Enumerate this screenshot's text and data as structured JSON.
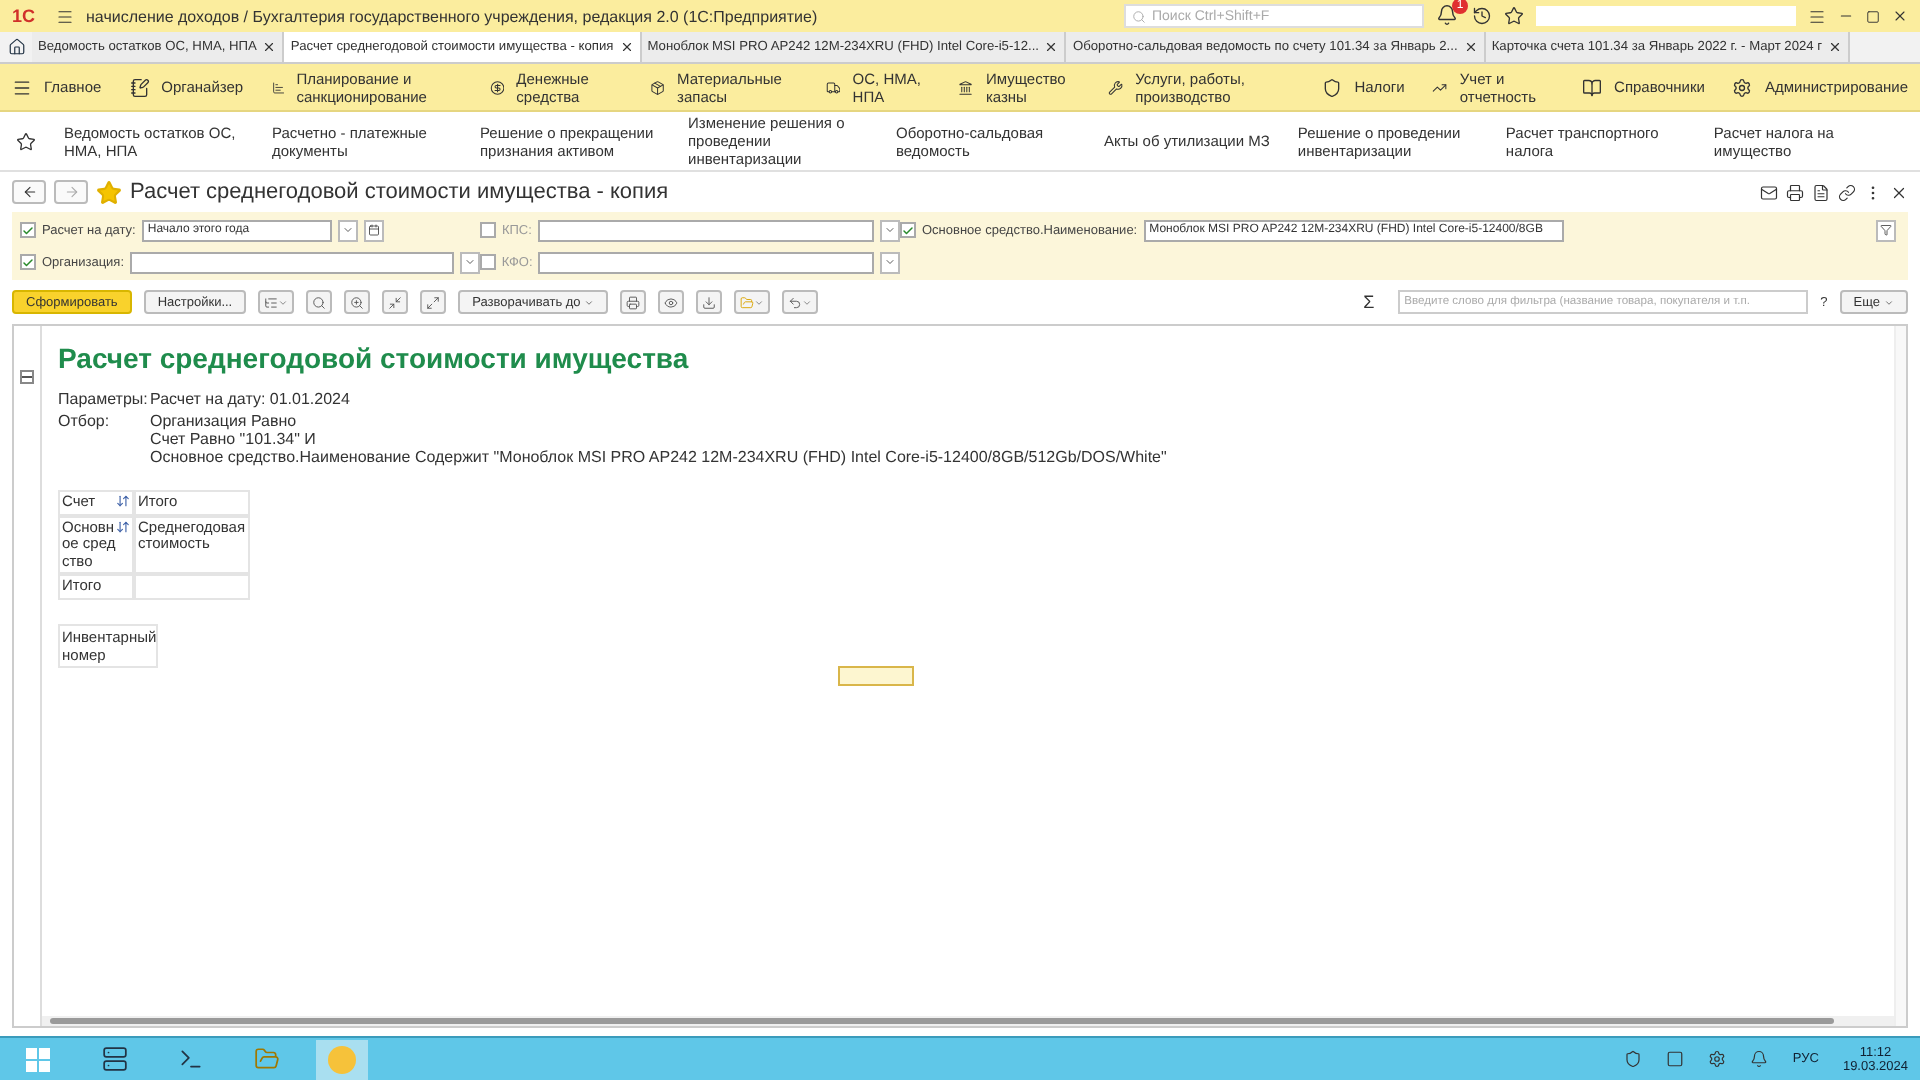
{
  "window": {
    "logo": "1С",
    "title": "начисление доходов / Бухгалтерия государственного учреждения, редакция 2.0  (1С:Предприятие)",
    "search_placeholder": "Поиск Ctrl+Shift+F",
    "notifications_count": "1"
  },
  "open_tabs": [
    {
      "label": "Ведомость остатков ОС, НМА, НПА",
      "selected": false
    },
    {
      "label": "Расчет среднегодовой стоимости имущества - копия",
      "selected": true
    },
    {
      "label": "Моноблок MSI PRO AP242 12M-234XRU (FHD) Intel Core-i5-12...",
      "selected": false
    },
    {
      "label": "Оборотно-сальдовая ведомость по счету 101.34 за Январь 2...",
      "selected": false
    },
    {
      "label": "Карточка счета 101.34 за Январь 2022 г. - Март 2024 г",
      "selected": false
    }
  ],
  "sections": [
    "Главное",
    "Органайзер",
    "Планирование и санкционирование",
    "Денежные средства",
    "Материальные запасы",
    "ОС, НМА, НПА",
    "Имущество казны",
    "Услуги, работы, производство",
    "Налоги",
    "Учет и отчетность",
    "Справочники",
    "Администрирование"
  ],
  "nav_links": [
    "Ведомость остатков ОС, НМА, НПА",
    "Расчетно - платежные документы",
    "Решение о прекращении признания активом",
    "Изменение решения о проведении инвентаризации",
    "Оборотно-сальдовая ведомость",
    "Акты об утилизации МЗ",
    "Решение о проведении инвентаризации",
    "Расчет транспортного налога",
    "Расчет налога на имущество"
  ],
  "form": {
    "title": "Расчет среднегодовой стоимости имущества - копия",
    "favorite": true
  },
  "filters": [
    {
      "label": "Расчет на дату:",
      "checked": true,
      "value": "Начало этого года",
      "kind": "date"
    },
    {
      "label": "КПС:",
      "checked": false,
      "kind": "select"
    },
    {
      "label": "Основное средство.Наименование:",
      "checked": true,
      "value": "Моноблок MSI PRO AP242 12M-234XRU (FHD) Intel Core-i5-12400/8GB",
      "kind": "text"
    },
    {
      "label": "Организация:",
      "checked": true,
      "kind": "select"
    },
    {
      "label": "КФО:",
      "checked": false,
      "kind": "select"
    }
  ],
  "toolbar": {
    "generate": "Сформировать",
    "settings": "Настройки...",
    "expand": "Разворачивать до",
    "filter_placeholder": "Введите слово для фильтра (название товара, покупателя и т.п.",
    "more": "Еще",
    "help": "?",
    "sum": "Σ"
  },
  "report": {
    "title": "Расчет среднегодовой стоимости имущества",
    "params": [
      {
        "label": "Параметры:",
        "lines": [
          "Расчет на дату: 01.01.2024"
        ]
      },
      {
        "label": "Отбор:",
        "lines": [
          "Организация Равно",
          "Счет Равно \"101.34\" И",
          "Основное средство.Наименование Содержит \"Моноблок MSI PRO AP242 12M-234XRU (FHD) Intel Core-i5-12400/8GB/512Gb/DOS/White\""
        ]
      }
    ],
    "table": [
      {
        "cells": [
          "Счет",
          "Итого"
        ],
        "sortable": true
      },
      {
        "cells": [
          "Основное средство",
          "Среднегодовая стоимость"
        ],
        "sortable": true
      },
      {
        "cells": [
          "Итого"
        ],
        "sortable": false
      }
    ],
    "extra_header": "Инвентарный номер"
  },
  "taskbar": {
    "language": "РУС",
    "time": "11:12",
    "date": "19.03.2024"
  }
}
